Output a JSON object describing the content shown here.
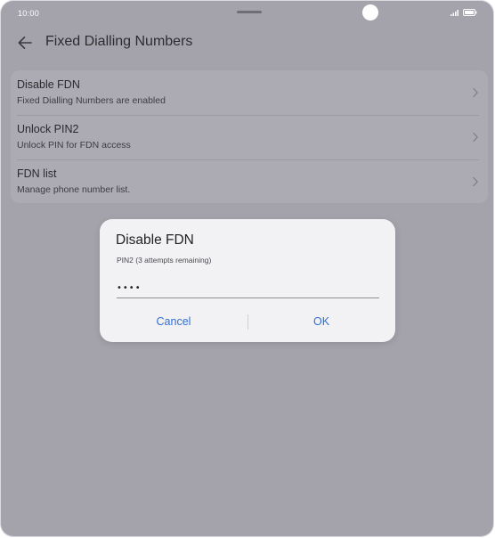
{
  "status_bar": {
    "time": "10:00"
  },
  "app_bar": {
    "back_icon": "arrow-left-icon",
    "title": "Fixed Dialling Numbers"
  },
  "settings_list": [
    {
      "title": "Disable FDN",
      "subtitle": "Fixed Dialling Numbers are enabled"
    },
    {
      "title": "Unlock PIN2",
      "subtitle": "Unlock PIN for FDN access"
    },
    {
      "title": "FDN list",
      "subtitle": "Manage phone number list."
    }
  ],
  "dialog": {
    "title": "Disable FDN",
    "subtitle": "PIN2 (3 attempts remaining)",
    "pin_value": "••••",
    "cancel_label": "Cancel",
    "ok_label": "OK"
  },
  "colors": {
    "scrim": "#a4a3ab",
    "dialog_background": "#f2f2f4",
    "accent": "#2f6fd6"
  }
}
